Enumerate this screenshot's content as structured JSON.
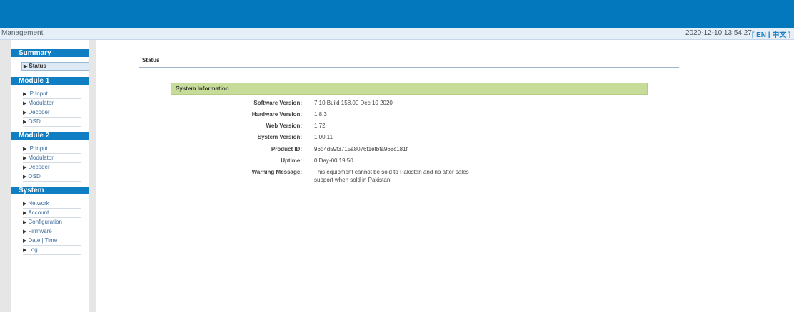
{
  "header": {
    "app_title": "Management",
    "datetime": "2020-12-10 13:54:27",
    "lang_open": "[ ",
    "lang_en": "EN",
    "lang_sep": " | ",
    "lang_zh": "中文",
    "lang_close": " ]"
  },
  "sidebar": {
    "sections": [
      {
        "title": "Summary",
        "items": [
          "Status"
        ]
      },
      {
        "title": "Module 1",
        "items": [
          "IP Input",
          "Modulator",
          "Decoder",
          "OSD"
        ]
      },
      {
        "title": "Module 2",
        "items": [
          "IP Input",
          "Modulator",
          "Decoder",
          "OSD"
        ]
      },
      {
        "title": "System",
        "items": [
          "Network",
          "Account",
          "Configuration",
          "Firmware",
          "Date | Time",
          "Log"
        ]
      }
    ],
    "active_item": "Status",
    "arrow_glyph": "▶"
  },
  "main": {
    "page_title": "Status",
    "panel_title": "System Information",
    "rows": [
      {
        "label": "Software Version:",
        "value": "7.10 Build 158.00 Dec 10 2020"
      },
      {
        "label": "Hardware Version:",
        "value": "1.8.3"
      },
      {
        "label": "Web Version:",
        "value": "1.72"
      },
      {
        "label": "System Version:",
        "value": "1.00.11"
      },
      {
        "label": "Product ID:",
        "value": "96d4d59f3715a8076f1efbfa968c181f"
      },
      {
        "label": "Uptime:",
        "value": "0 Day-00:19:50"
      },
      {
        "label": "Warning Message:",
        "value": "This equipment cannot be sold to Pakistan and no after sales support when sold in Pakistan."
      }
    ]
  },
  "colors": {
    "header_blue": "#0478bd",
    "section_blue": "#0f7ec3",
    "panel_green": "#c8dc9a"
  }
}
